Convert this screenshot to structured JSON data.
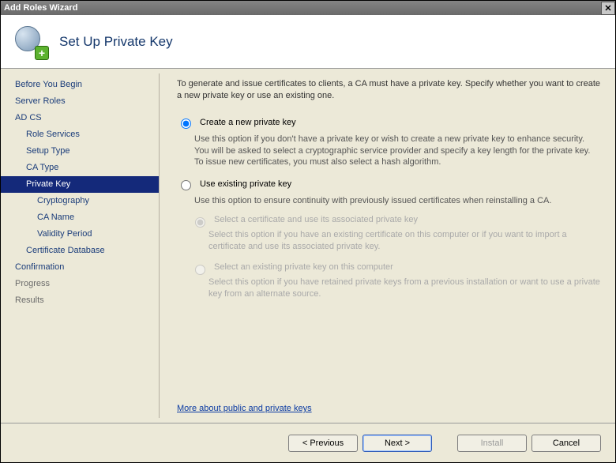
{
  "window": {
    "title": "Add Roles Wizard"
  },
  "header": {
    "title": "Set Up Private Key"
  },
  "sidebar": {
    "items": [
      {
        "label": "Before You Begin",
        "cls": "item"
      },
      {
        "label": "Server Roles",
        "cls": "item"
      },
      {
        "label": "AD CS",
        "cls": "item"
      },
      {
        "label": "Role Services",
        "cls": "item sub"
      },
      {
        "label": "Setup Type",
        "cls": "item sub"
      },
      {
        "label": "CA Type",
        "cls": "item sub"
      },
      {
        "label": "Private Key",
        "cls": "item sub selected"
      },
      {
        "label": "Cryptography",
        "cls": "item sub2"
      },
      {
        "label": "CA Name",
        "cls": "item sub2"
      },
      {
        "label": "Validity Period",
        "cls": "item sub2"
      },
      {
        "label": "Certificate Database",
        "cls": "item sub"
      },
      {
        "label": "Confirmation",
        "cls": "item"
      },
      {
        "label": "Progress",
        "cls": "item dim"
      },
      {
        "label": "Results",
        "cls": "item dim"
      }
    ]
  },
  "content": {
    "intro": "To generate and issue certificates to clients, a CA must have a private key. Specify whether you want to create a new private key or use an existing one.",
    "opt1": {
      "label": "Create a new private key",
      "desc": "Use this option if you don't have a private key or wish to create a new private key to enhance security. You will be asked to select a cryptographic service provider and specify a key length for the private key. To issue new certificates, you must also select a hash algorithm."
    },
    "opt2": {
      "label": "Use existing private key",
      "desc": "Use this option to ensure continuity with previously issued certificates when reinstalling a CA."
    },
    "sub1": {
      "label": "Select a certificate and use its associated private key",
      "desc": "Select this option if you have an existing certificate on this computer or if you want to import a certificate and use its associated private key."
    },
    "sub2": {
      "label": "Select an existing private key on this computer",
      "desc": "Select this option if you have retained private keys from a previous installation or want to use a private key from an alternate source."
    },
    "more_link": "More about public and private keys"
  },
  "footer": {
    "previous": "< Previous",
    "next": "Next >",
    "install": "Install",
    "cancel": "Cancel"
  }
}
